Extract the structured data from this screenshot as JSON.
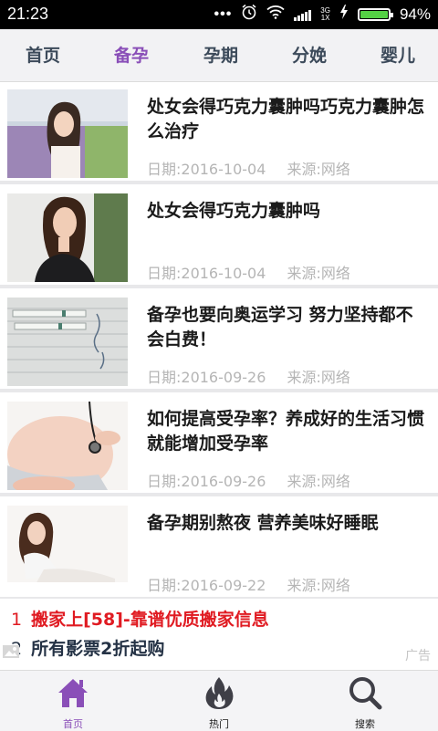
{
  "status": {
    "time": "21:23",
    "net_top": "3G",
    "net_bottom": "1X",
    "battery": "94%"
  },
  "tabs": [
    {
      "label": "首页"
    },
    {
      "label": "备孕"
    },
    {
      "label": "孕期"
    },
    {
      "label": "分娩"
    },
    {
      "label": "婴儿"
    }
  ],
  "active_tab": "备孕",
  "articles": [
    {
      "title": "处女会得巧克力囊肿吗巧克力囊肿怎么治疗",
      "date": "日期:2016-10-04",
      "source": "来源:网络"
    },
    {
      "title": "处女会得巧克力囊肿吗",
      "date": "日期:2016-10-04",
      "source": "来源:网络"
    },
    {
      "title": "备孕也要向奥运学习 努力坚持都不会白费！",
      "date": "日期:2016-09-26",
      "source": "来源:网络"
    },
    {
      "title": "如何提高受孕率？养成好的生活习惯就能增加受孕率",
      "date": "日期:2016-09-26",
      "source": "来源:网络"
    },
    {
      "title": "备孕期别熬夜 营养美味好睡眠",
      "date": "日期:2016-09-22",
      "source": "来源:网络"
    }
  ],
  "ads": [
    {
      "num": "1",
      "text": "搬家上[58]-靠谱优质搬家信息"
    },
    {
      "num": "2",
      "text": "所有影票2折起购"
    }
  ],
  "ad_label": "广告",
  "bottom_nav": [
    {
      "label": "首页",
      "icon": "home-icon"
    },
    {
      "label": "热门",
      "icon": "flame-icon"
    },
    {
      "label": "搜索",
      "icon": "search-icon"
    }
  ],
  "colors": {
    "accent": "#8a4fb8",
    "ad_red": "#e01b22",
    "battery_green": "#54d145"
  }
}
